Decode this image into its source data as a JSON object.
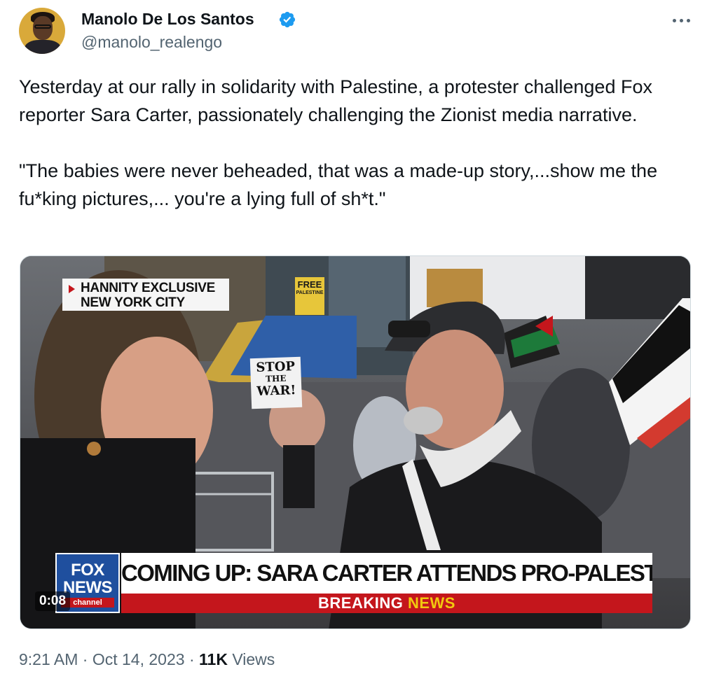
{
  "author": {
    "name": "Manolo De Los Santos",
    "handle": "@manolo_realengo",
    "verified_icon": "verified-badge-icon",
    "verified_color": "#1d9bf0"
  },
  "tweet": {
    "paragraphs": [
      "Yesterday at our rally in solidarity with Palestine, a protester challenged Fox reporter Sara Carter, passionately challenging the Zionist media narrative.",
      "\"The babies were never beheaded, that was a made-up story,...show me the fu*king pictures,... you're a lying full of sh*t.\""
    ]
  },
  "video": {
    "bug_line1": "HANNITY EXCLUSIVE",
    "bug_line2": "NEW YORK CITY",
    "sign_free_line1": "FREE",
    "sign_free_line2": "PALESTINE",
    "sign_stop_line1": "STOP",
    "sign_stop_line2": "THE",
    "sign_stop_line3": "WAR!",
    "logo_line1": "FOX",
    "logo_line2": "NEWS",
    "logo_line3": "channel",
    "headline": "COMING UP: SARA CARTER ATTENDS PRO-PALESTINE RALLY",
    "breaking_word": "BREAKING",
    "news_word": "NEWS",
    "timecode": "0:08",
    "brand_red": "#c4161c",
    "brand_blue": "#1f4f9e",
    "accent_yellow": "#f2c80f"
  },
  "meta": {
    "time": "9:21 AM",
    "date": "Oct 14, 2023",
    "views_count": "11K",
    "views_label": "Views",
    "separator": "·"
  }
}
